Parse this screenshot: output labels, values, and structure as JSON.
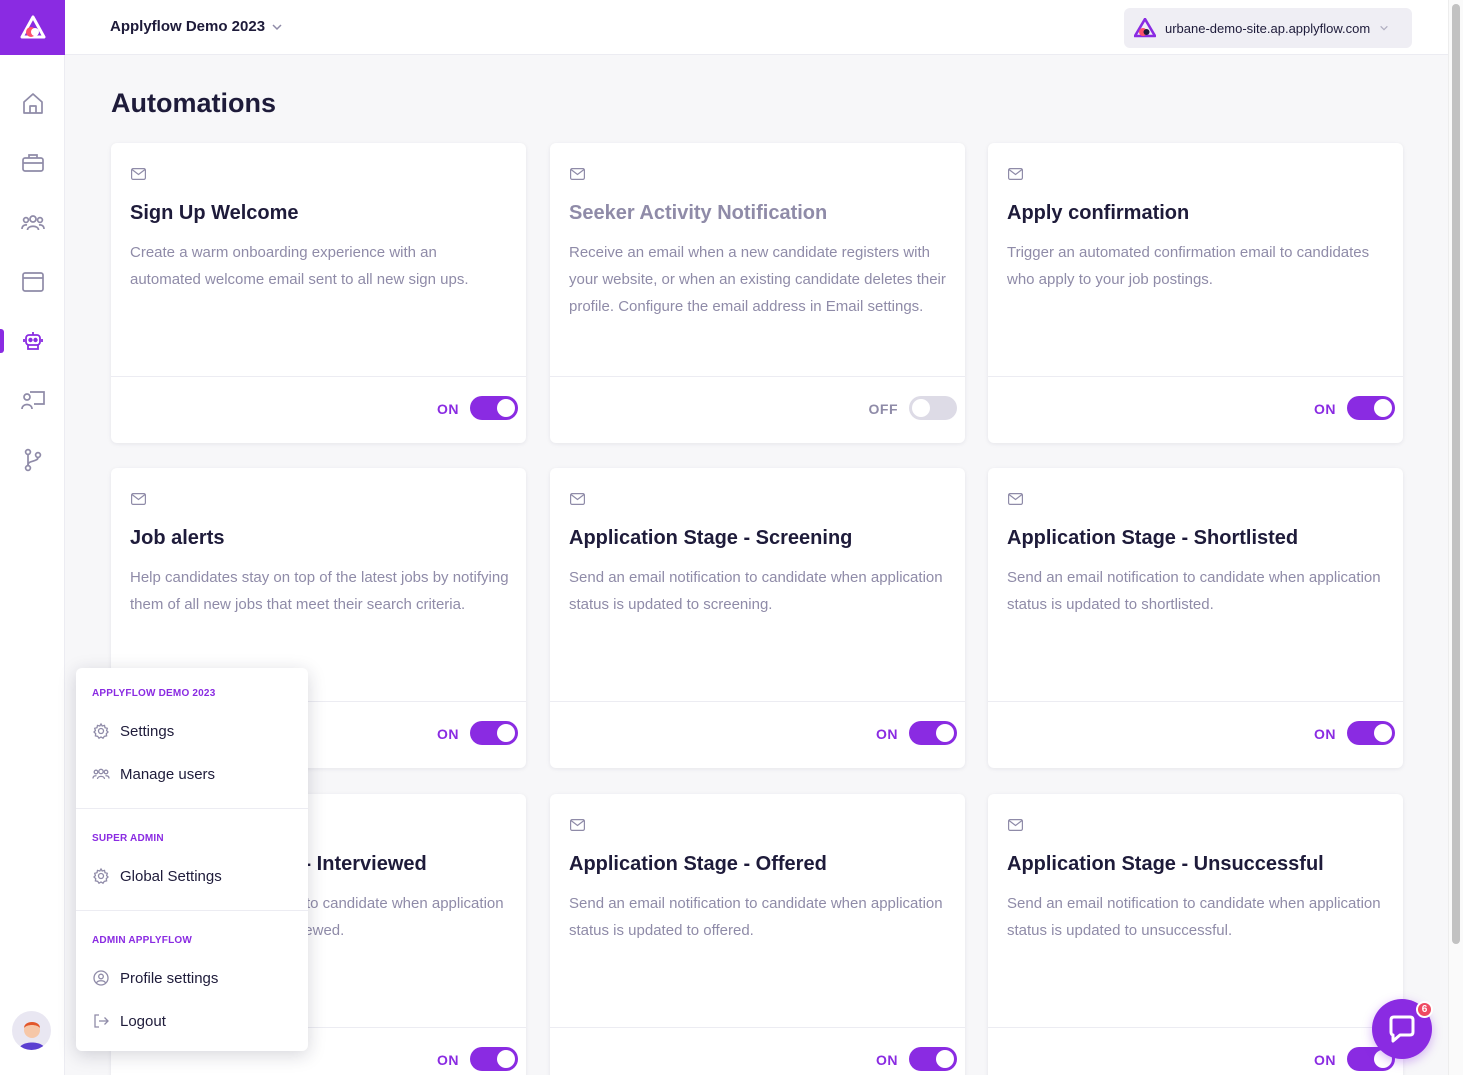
{
  "topbar": {
    "workspace_name": "Applyflow Demo 2023",
    "site_url": "urbane-demo-site.ap.applyflow.com"
  },
  "page": {
    "title": "Automations"
  },
  "sidebar": {
    "items": [
      {
        "icon": "home-icon",
        "active": false
      },
      {
        "icon": "briefcase-icon",
        "active": false
      },
      {
        "icon": "users-icon",
        "active": false
      },
      {
        "icon": "browser-window-icon",
        "active": false
      },
      {
        "icon": "robot-icon",
        "active": true
      },
      {
        "icon": "presentation-user-icon",
        "active": false
      },
      {
        "icon": "git-branch-icon",
        "active": false
      }
    ]
  },
  "cards": [
    {
      "title": "Sign Up Welcome",
      "description": "Create a warm onboarding experience with an automated welcome email sent to all new sign ups.",
      "status": "ON"
    },
    {
      "title": "Seeker Activity Notification",
      "description": "Receive an email when a new candidate registers with your website, or when an existing candidate deletes their profile. Configure the email address in Email settings.",
      "status": "OFF"
    },
    {
      "title": "Apply confirmation",
      "description": "Trigger an automated confirmation email to candidates who apply to your job postings.",
      "status": "ON"
    },
    {
      "title": "Job alerts",
      "description": "Help candidates stay on top of the latest jobs by notifying them of all new jobs that meet their search criteria.",
      "status": "ON"
    },
    {
      "title": "Application Stage - Screening",
      "description": "Send an email notification to candidate when application status is updated to screening.",
      "status": "ON"
    },
    {
      "title": "Application Stage - Shortlisted",
      "description": "Send an email notification to candidate when application status is updated to shortlisted.",
      "status": "ON"
    },
    {
      "title": "Application Stage - Interviewed",
      "description": "Send an email notification to candidate when application status is updated to interviewed.",
      "status": "ON"
    },
    {
      "title": "Application Stage - Offered",
      "description": "Send an email notification to candidate when application status is updated to offered.",
      "status": "ON"
    },
    {
      "title": "Application Stage - Unsuccessful",
      "description": "Send an email notification to candidate when application status is updated to unsuccessful.",
      "status": "ON"
    }
  ],
  "popup_menu": {
    "section1": {
      "label": "APPLYFLOW DEMO 2023",
      "items": [
        "Settings",
        "Manage users"
      ]
    },
    "section2": {
      "label": "SUPER ADMIN",
      "items": [
        "Global Settings"
      ]
    },
    "section3": {
      "label": "ADMIN APPLYFLOW",
      "items": [
        "Profile settings",
        "Logout"
      ]
    }
  },
  "chat": {
    "badge_count": "6"
  },
  "colors": {
    "accent": "#8a2be2",
    "text": "#1e1b3a",
    "muted": "#8f8ba8",
    "badge": "#ef4a62"
  }
}
